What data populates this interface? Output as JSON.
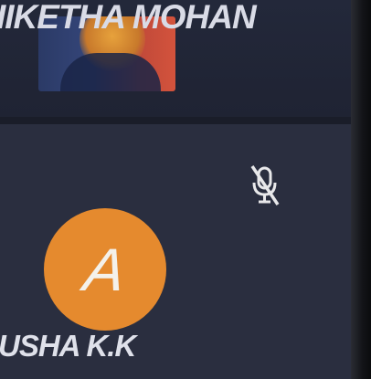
{
  "participants": [
    {
      "name": "IIKETHA MOHAN",
      "video": "on"
    },
    {
      "name": "USHA K.K",
      "avatar_initial": "A",
      "avatar_color": "#e58a2e",
      "mic_icon": "mic-muted-icon"
    }
  ]
}
